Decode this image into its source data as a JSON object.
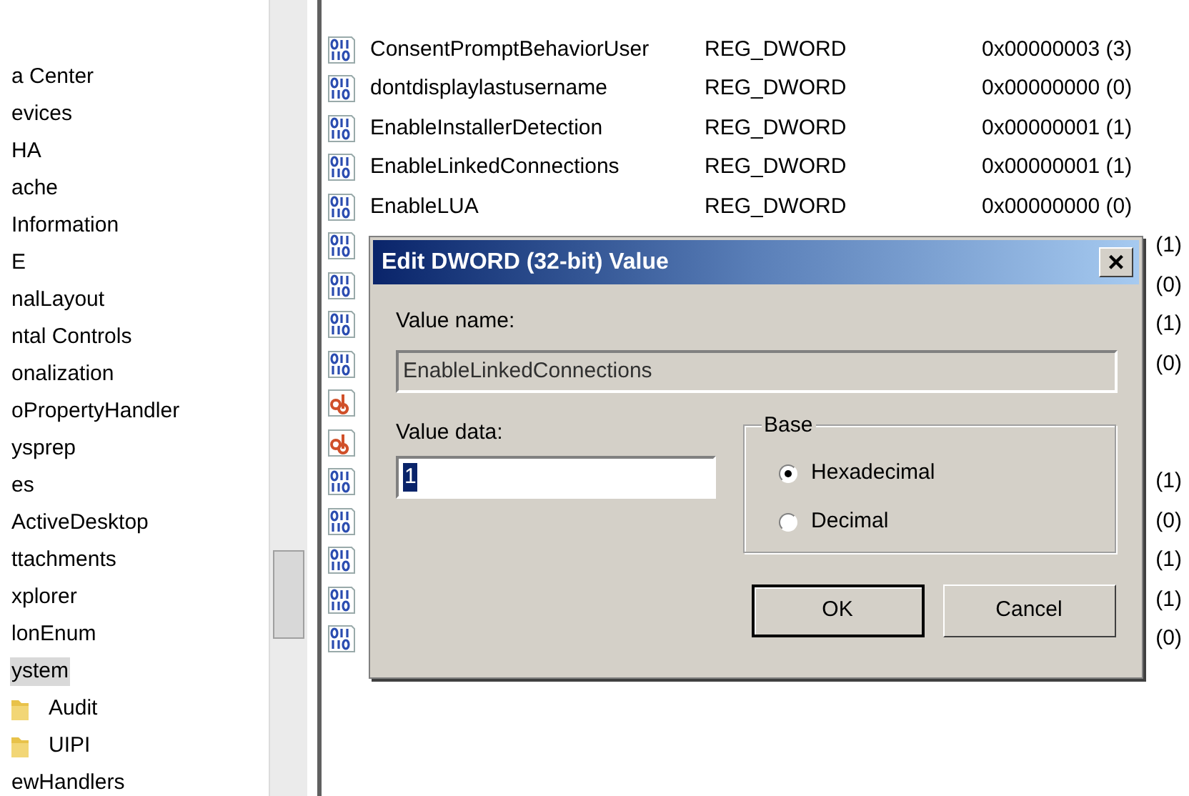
{
  "tree": {
    "items": [
      {
        "label": "a Center",
        "selected": false
      },
      {
        "label": "evices",
        "selected": false
      },
      {
        "label": "HA",
        "selected": false
      },
      {
        "label": "ache",
        "selected": false
      },
      {
        "label": "Information",
        "selected": false
      },
      {
        "label": "E",
        "selected": false
      },
      {
        "label": "nalLayout",
        "selected": false
      },
      {
        "label": "ntal Controls",
        "selected": false
      },
      {
        "label": "onalization",
        "selected": false
      },
      {
        "label": "oPropertyHandler",
        "selected": false
      },
      {
        "label": "ysprep",
        "selected": false
      },
      {
        "label": "es",
        "selected": false
      },
      {
        "label": "ActiveDesktop",
        "selected": false
      },
      {
        "label": "ttachments",
        "selected": false
      },
      {
        "label": "xplorer",
        "selected": false
      },
      {
        "label": "lonEnum",
        "selected": false
      },
      {
        "label": "ystem",
        "selected": true,
        "children": [
          {
            "label": "Audit",
            "selected": false
          },
          {
            "label": "UIPI",
            "selected": false
          }
        ]
      },
      {
        "label": "ewHandlers",
        "selected": false
      }
    ]
  },
  "values": {
    "rows": [
      {
        "kind": "binary",
        "name": "ConsentPromptBehaviorUser",
        "type": "REG_DWORD",
        "data": "0x00000003 (3)"
      },
      {
        "kind": "binary",
        "name": "dontdisplaylastusername",
        "type": "REG_DWORD",
        "data": "0x00000000 (0)"
      },
      {
        "kind": "binary",
        "name": "EnableInstallerDetection",
        "type": "REG_DWORD",
        "data": "0x00000001 (1)"
      },
      {
        "kind": "binary",
        "name": "EnableLinkedConnections",
        "type": "REG_DWORD",
        "data": "0x00000001 (1)"
      },
      {
        "kind": "binary",
        "name": "EnableLUA",
        "type": "REG_DWORD",
        "data": "0x00000000 (0)"
      },
      {
        "kind": "binary",
        "data": "(1)"
      },
      {
        "kind": "binary",
        "data": "(0)"
      },
      {
        "kind": "binary",
        "data": "(1)"
      },
      {
        "kind": "binary",
        "data": "(0)"
      },
      {
        "kind": "string"
      },
      {
        "kind": "string"
      },
      {
        "kind": "binary",
        "data": "(1)"
      },
      {
        "kind": "binary",
        "data": "(0)"
      },
      {
        "kind": "binary",
        "data": "(1)"
      },
      {
        "kind": "binary",
        "data": "(1)"
      },
      {
        "kind": "binary",
        "data": "(0)"
      }
    ]
  },
  "dialog": {
    "title": "Edit DWORD (32-bit) Value",
    "close": "×",
    "value_name_label": "Value name:",
    "value_name": "EnableLinkedConnections",
    "value_data_label": "Value data:",
    "value_data": "1",
    "base": {
      "label": "Base",
      "options": [
        {
          "label": "Hexadecimal",
          "selected": true
        },
        {
          "label": "Decimal",
          "selected": false
        }
      ]
    },
    "buttons": [
      "OK",
      "Cancel"
    ]
  }
}
